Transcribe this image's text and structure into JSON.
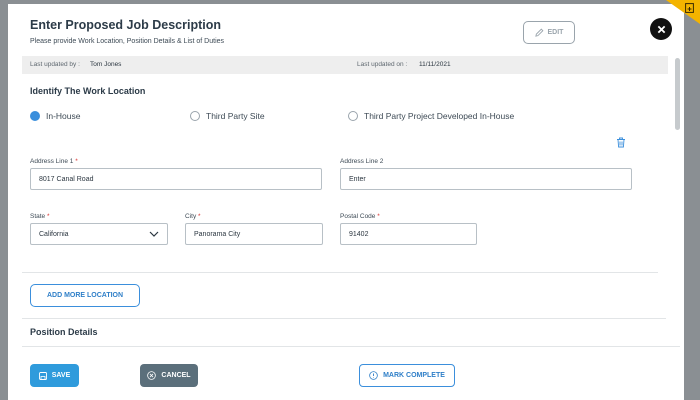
{
  "header": {
    "title": "Enter Proposed Job Description",
    "subtitle": "Please provide Work Location, Position Details & List of Duties",
    "edit_label": "EDIT"
  },
  "updated": {
    "by_label": "Last updated by :",
    "by_value": "Tom Jones",
    "on_label": "Last updated on :",
    "on_value": "11/11/2021"
  },
  "work_location": {
    "heading": "Identify The Work Location",
    "options": [
      {
        "label": "In-House",
        "selected": true
      },
      {
        "label": "Third Party Site",
        "selected": false
      },
      {
        "label": "Third Party Project Developed In-House",
        "selected": false
      }
    ]
  },
  "fields": {
    "address1": {
      "label": "Address Line 1",
      "value": "8017 Canal Road"
    },
    "address2": {
      "label": "Address Line 2",
      "placeholder": "Enter"
    },
    "state": {
      "label": "State",
      "value": "California"
    },
    "city": {
      "label": "City",
      "value": "Panorama City"
    },
    "postal": {
      "label": "Postal Code",
      "value": "91402"
    },
    "required_mark": "*"
  },
  "add_location_label": "ADD MORE LOCATION",
  "position_heading": "Position Details",
  "footer": {
    "save_label": "SAVE",
    "cancel_label": "CANCEL",
    "complete_label": "MARK COMPLETE"
  },
  "colors": {
    "accent": "#3b8fdc",
    "cancel": "#5b6f7b",
    "required": "#d9302c"
  },
  "icons": [
    "pencil-icon",
    "close-icon",
    "trash-icon",
    "save-icon",
    "cancel-icon",
    "check-circle-icon",
    "chevron-down-icon",
    "note-icon"
  ]
}
